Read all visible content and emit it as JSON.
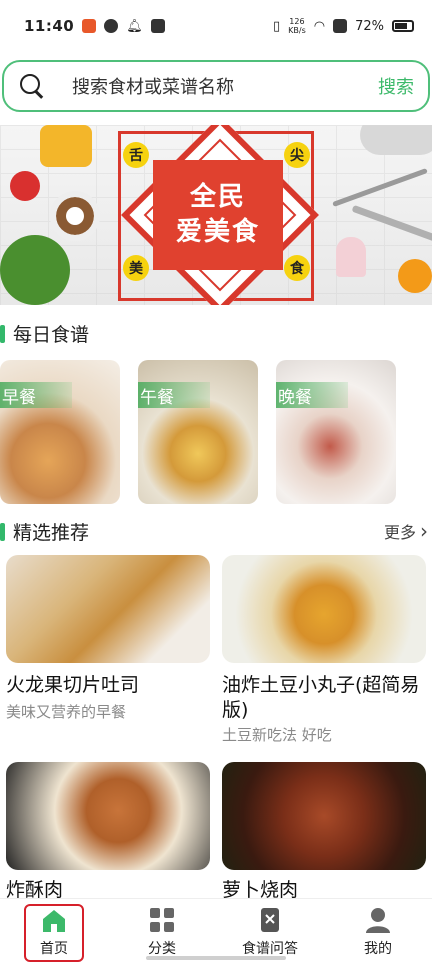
{
  "status_bar": {
    "time": "11:40",
    "net_speed": "126\nKB/s",
    "battery": "72%"
  },
  "search": {
    "placeholder": "搜索食材或菜谱名称",
    "button": "搜索"
  },
  "banner": {
    "line1": "全民",
    "line2": "爱美食",
    "corners": [
      "舌",
      "尖",
      "美",
      "食"
    ]
  },
  "daily": {
    "title": "每日食谱",
    "meals": [
      "早餐",
      "午餐",
      "晚餐"
    ]
  },
  "featured": {
    "title": "精选推荐",
    "more": "更多",
    "cards": [
      {
        "title": "火龙果切片吐司",
        "subtitle": "美味又营养的早餐"
      },
      {
        "title": "油炸土豆小丸子(超简易版)",
        "subtitle": "土豆新吃法 好吃"
      },
      {
        "title": "炸酥肉",
        "subtitle": ""
      },
      {
        "title": "萝卜烧肉",
        "subtitle": ""
      }
    ]
  },
  "tabs": [
    {
      "label": "首页",
      "icon": "home-icon",
      "active": true
    },
    {
      "label": "分类",
      "icon": "grid-icon",
      "active": false
    },
    {
      "label": "食谱问答",
      "icon": "recipe-qa-icon",
      "active": false
    },
    {
      "label": "我的",
      "icon": "user-icon",
      "active": false
    }
  ],
  "colors": {
    "accent": "#3cb96a",
    "banner_red": "#e0412f",
    "selected_outline": "#d6202a"
  }
}
